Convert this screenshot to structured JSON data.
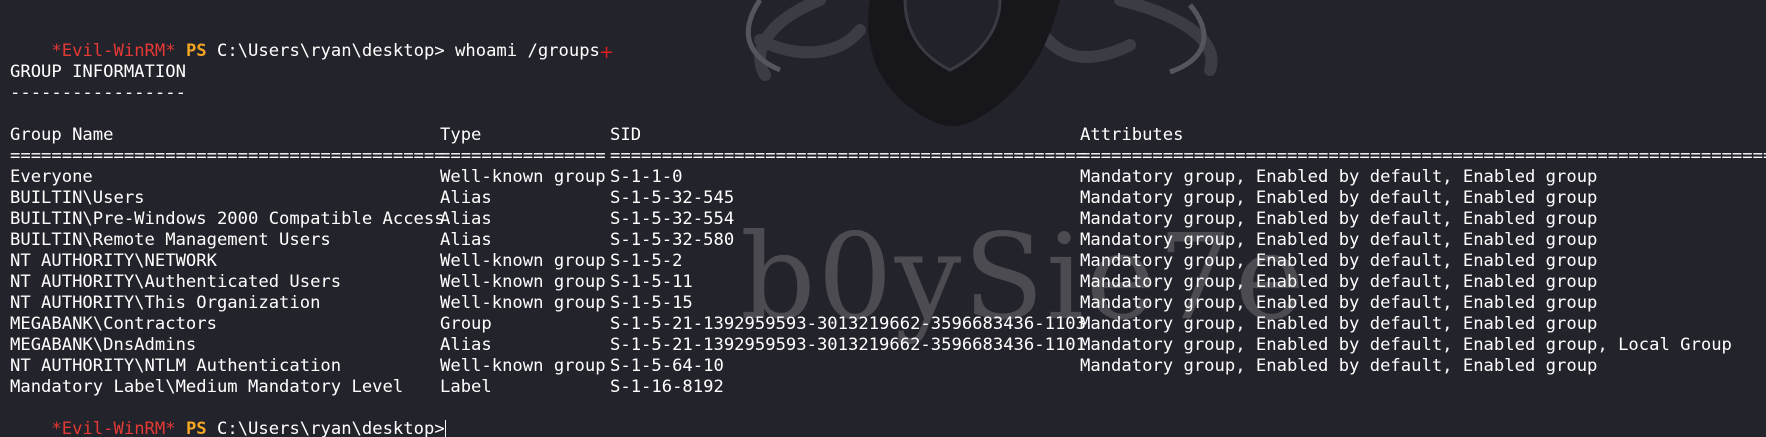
{
  "prompt": {
    "winrm_label": "*Evil-WinRM*",
    "ps_label": "PS",
    "path": "C:\\Users\\ryan\\desktop>",
    "command": "whoami /groups",
    "final_path": "C:\\Users\\ryan\\desktop>"
  },
  "output": {
    "heading": "GROUP INFORMATION",
    "heading_underline": "-----------------",
    "columns": {
      "name": "Group Name",
      "type": "Type",
      "sid": "SID",
      "attributes": "Attributes"
    },
    "separators": {
      "name": "==========================================",
      "type": "================",
      "sid": "==============================================",
      "attributes": "==================================================================="
    },
    "rows": [
      {
        "name": "Everyone",
        "type": "Well-known group",
        "sid": "S-1-1-0",
        "attributes": "Mandatory group, Enabled by default, Enabled group"
      },
      {
        "name": "BUILTIN\\Users",
        "type": "Alias",
        "sid": "S-1-5-32-545",
        "attributes": "Mandatory group, Enabled by default, Enabled group"
      },
      {
        "name": "BUILTIN\\Pre-Windows 2000 Compatible Access",
        "type": "Alias",
        "sid": "S-1-5-32-554",
        "attributes": "Mandatory group, Enabled by default, Enabled group"
      },
      {
        "name": "BUILTIN\\Remote Management Users",
        "type": "Alias",
        "sid": "S-1-5-32-580",
        "attributes": "Mandatory group, Enabled by default, Enabled group"
      },
      {
        "name": "NT AUTHORITY\\NETWORK",
        "type": "Well-known group",
        "sid": "S-1-5-2",
        "attributes": "Mandatory group, Enabled by default, Enabled group"
      },
      {
        "name": "NT AUTHORITY\\Authenticated Users",
        "type": "Well-known group",
        "sid": "S-1-5-11",
        "attributes": "Mandatory group, Enabled by default, Enabled group"
      },
      {
        "name": "NT AUTHORITY\\This Organization",
        "type": "Well-known group",
        "sid": "S-1-5-15",
        "attributes": "Mandatory group, Enabled by default, Enabled group"
      },
      {
        "name": "MEGABANK\\Contractors",
        "type": "Group",
        "sid": "S-1-5-21-1392959593-3013219662-3596683436-1103",
        "attributes": "Mandatory group, Enabled by default, Enabled group"
      },
      {
        "name": "MEGABANK\\DnsAdmins",
        "type": "Alias",
        "sid": "S-1-5-21-1392959593-3013219662-3596683436-1101",
        "attributes": "Mandatory group, Enabled by default, Enabled group, Local Group"
      },
      {
        "name": "NT AUTHORITY\\NTLM Authentication",
        "type": "Well-known group",
        "sid": "S-1-5-64-10",
        "attributes": "Mandatory group, Enabled by default, Enabled group"
      },
      {
        "name": "Mandatory Label\\Medium Mandatory Level",
        "type": "Label",
        "sid": "S-1-16-8192",
        "attributes": ""
      }
    ]
  },
  "watermark": {
    "text": "b0ySie7e"
  },
  "colors": {
    "background": "#23232b",
    "winrm": "#e53935",
    "ps": "#f5a623",
    "text": "#ffffff",
    "watermark": "#4b4b51"
  },
  "icons": {
    "crosshair": "crosshair-icon",
    "cursor": "text-cursor"
  }
}
